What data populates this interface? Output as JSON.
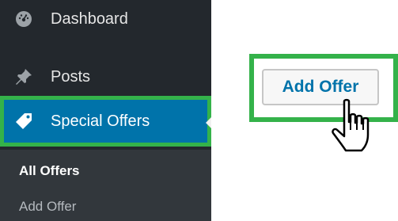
{
  "sidebar": {
    "items": [
      {
        "label": "Dashboard",
        "icon": "dashboard-icon"
      },
      {
        "label": "Posts",
        "icon": "pin-icon"
      },
      {
        "label": "Special Offers",
        "icon": "tag-icon",
        "active": true
      }
    ],
    "submenu": {
      "items": [
        {
          "label": "All Offers",
          "current": true
        },
        {
          "label": "Add Offer",
          "current": false
        }
      ]
    }
  },
  "callout": {
    "button_label": "Add Offer",
    "cursor_icon": "hand-pointer-icon"
  },
  "colors": {
    "sidebar_bg": "#23282d",
    "submenu_bg": "#32373c",
    "active_bg": "#0073aa",
    "highlight_border": "#34b24a",
    "button_text": "#0073aa"
  }
}
